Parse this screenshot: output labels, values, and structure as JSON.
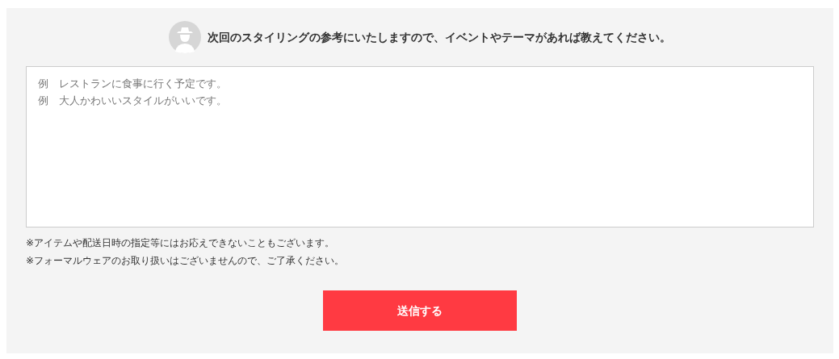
{
  "heading": "次回のスタイリングの参考にいたしますので、イベントやテーマがあれば教えてください。",
  "request_field": {
    "placeholder_lines": [
      "例　レストランに食事に行く予定です。",
      "例　大人かわいいスタイルがいいです。"
    ]
  },
  "notes": [
    "※アイテムや配送日時の指定等にはお応えできないこともございます。",
    "※フォーマルウェアのお取り扱いはございませんので、ご了承ください。"
  ],
  "submit_button": "送信する"
}
